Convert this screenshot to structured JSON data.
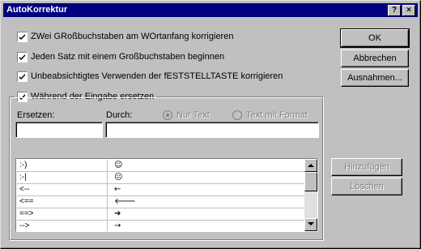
{
  "window": {
    "title": "AutoKorrektur",
    "help_label": "?",
    "close_label": "×"
  },
  "options": [
    {
      "label": "ZWei GRoßbuchstaben am WOrtanfang korrigieren",
      "checked": true
    },
    {
      "label": "Jeden Satz mit einem Großbuchstaben beginnen",
      "checked": true
    },
    {
      "label": "Unbeabsichtigtes Verwenden der fESTSTELLTASTE korrigieren",
      "checked": true
    }
  ],
  "replace_group": {
    "label": "Während der Eingabe ersetzen",
    "checked": true,
    "replace_label": "Ersetzen:",
    "with_label": "Durch:",
    "replace_value": "",
    "with_value": "",
    "radio_plain": "Nur Text",
    "radio_formatted": "Text mit Format"
  },
  "buttons": {
    "ok": "OK",
    "cancel": "Abbrechen",
    "exceptions": "Ausnahmen...",
    "add": "Hinzufügen",
    "delete": "Löschen"
  },
  "entries": [
    {
      "replace": ":-)",
      "with": "☺"
    },
    {
      "replace": ":-|",
      "with": "😐"
    },
    {
      "replace": "<--",
      "with": "←"
    },
    {
      "replace": "<==",
      "with": "🡐"
    },
    {
      "replace": "==>",
      "with": "➔"
    },
    {
      "replace": "-->",
      "with": "→"
    }
  ],
  "colors": {
    "title_bar": "#000080",
    "face": "#c0c0c0"
  }
}
